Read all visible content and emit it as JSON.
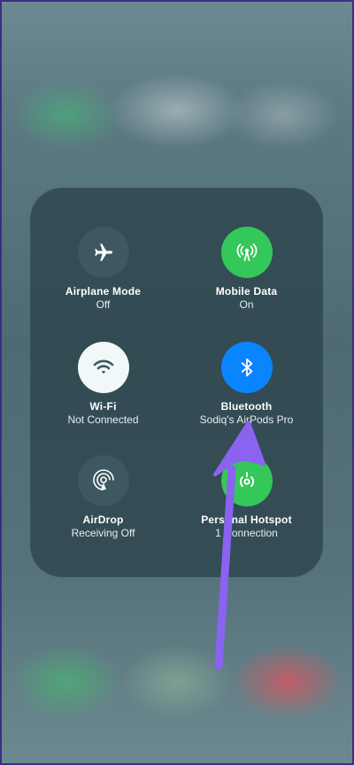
{
  "control_center": {
    "toggles": [
      {
        "label": "Airplane Mode",
        "status": "Off",
        "icon": "airplane-icon",
        "color": "#3d5860"
      },
      {
        "label": "Mobile Data",
        "status": "On",
        "icon": "antenna-icon",
        "color": "#34c759"
      },
      {
        "label": "Wi-Fi",
        "status": "Not Connected",
        "icon": "wifi-icon",
        "color": "#f2f7f8"
      },
      {
        "label": "Bluetooth",
        "status": "Sodiq's AirPods Pro",
        "icon": "bluetooth-icon",
        "color": "#0a84ff"
      },
      {
        "label": "AirDrop",
        "status": "Receiving Off",
        "icon": "airdrop-icon",
        "color": "#3d5860"
      },
      {
        "label": "Personal Hotspot",
        "status": "1 Connection",
        "icon": "hotspot-icon",
        "color": "#34c759"
      }
    ]
  },
  "annotation": {
    "color": "#8a63f0"
  }
}
